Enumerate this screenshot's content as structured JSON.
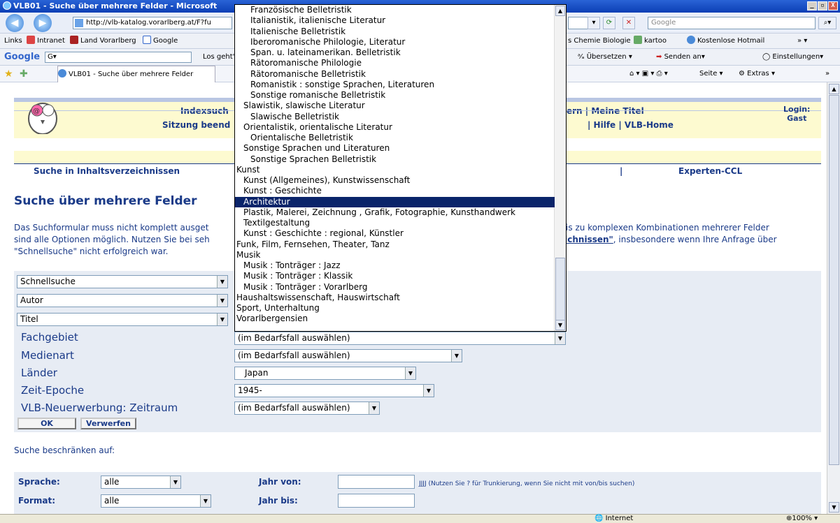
{
  "window": {
    "title": "VLB01 - Suche über mehrere Felder - Microsoft",
    "btns": [
      "_",
      "▫",
      "X"
    ]
  },
  "address": {
    "url": "http://vlb-katalog.vorarlberg.at/F?fu",
    "search_placeholder": "Google"
  },
  "links": {
    "label": "Links",
    "items": [
      "Intranet",
      "Land Vorarlberg",
      "Google"
    ],
    "right_items": [
      "s Chemie Biologie",
      "kartoo",
      "Kostenlose Hotmail"
    ]
  },
  "googlebar": {
    "logo": "Google",
    "field": "G▾",
    "mid": "Los geht's",
    "translate": "Übersetzen",
    "send": "Senden an▾",
    "settings": "Einstellungen▾"
  },
  "tab": {
    "label": "VLB01 - Suche über mehrere Felder",
    "page": "Seite",
    "extras": "Extras"
  },
  "header": {
    "row1a": "Indexsuch",
    "row1b": "ern | Meine Titel",
    "row2a": "Sitzung beend",
    "row2b": "| Hilfe | VLB-Home",
    "login": "Login:",
    "login_user": "Gast"
  },
  "nav": {
    "left": "Suche in Inhaltsverzeichnissen",
    "sep": "|",
    "right": "Experten-CCL"
  },
  "page": {
    "title": "Suche über mehrere Felder",
    "intro_l1a": "Das Suchformular muss nicht komplett ausget",
    "intro_l1b": "d bis zu komplexen Kombinationen mehrerer Felder",
    "intro_l2a": "sind alle Optionen möglich. Nutzen Sie bei seh",
    "intro_l2b": "eichnissen\"",
    "intro_l2c": ", insbesondere wenn Ihre Anfrage über",
    "intro_l3": "\"Schnellsuche\" nicht erfolgreich war."
  },
  "form": {
    "field_selects": [
      "Schnellsuche",
      "Autor",
      "Titel"
    ],
    "labels": [
      "Fachgebiet",
      "Medienart",
      "Länder",
      "Zeit-Epoche",
      "VLB-Neuerwerbung: Zeitraum"
    ],
    "values": [
      "(im Bedarfsfall auswählen)",
      "(im Bedarfsfall auswählen)",
      "Japan",
      "1945-",
      "(im Bedarfsfall auswählen)"
    ],
    "ok": "OK",
    "reset": "Verwerfen"
  },
  "limit": {
    "title": "Suche beschränken auf:",
    "sprache_label": "Sprache:",
    "sprache": "alle",
    "format_label": "Format:",
    "format": "alle",
    "jahr_von": "Jahr von:",
    "jahr_bis": "Jahr bis:",
    "hint": "JJJJ (Nutzen Sie ? für Trunkierung, wenn Sie nicht mit von/bis suchen)"
  },
  "dropdown": {
    "selected_index": 19,
    "items": [
      {
        "t": "Französische Belletristik",
        "i": 2
      },
      {
        "t": "Italianistik, italienische Literatur",
        "i": 2
      },
      {
        "t": "Italienische Belletristik",
        "i": 2
      },
      {
        "t": "Iberoromanische Philologie, Literatur",
        "i": 2
      },
      {
        "t": "Span. u. lateinamerikan. Belletristik",
        "i": 2
      },
      {
        "t": "Rätoromanische Philologie",
        "i": 2
      },
      {
        "t": "Rätoromanische Belletristik",
        "i": 2
      },
      {
        "t": "Romanistik : sonstige Sprachen, Literaturen",
        "i": 2
      },
      {
        "t": "Sonstige romanische Belletristik",
        "i": 2
      },
      {
        "t": "Slawistik, slawische Literatur",
        "i": 1
      },
      {
        "t": "Slawische Belletristik",
        "i": 2
      },
      {
        "t": "Orientalistik, orientalische Literatur",
        "i": 1
      },
      {
        "t": "Orientalische Belletristik",
        "i": 2
      },
      {
        "t": "Sonstige Sprachen und Literaturen",
        "i": 1
      },
      {
        "t": "Sonstige Sprachen Belletristik",
        "i": 2
      },
      {
        "t": "Kunst",
        "i": 0
      },
      {
        "t": "Kunst (Allgemeines), Kunstwissenschaft",
        "i": 1
      },
      {
        "t": "Kunst : Geschichte",
        "i": 1
      },
      {
        "t": "Architektur",
        "i": 1
      },
      {
        "t": "Plastik, Malerei, Zeichnung , Grafik, Fotographie, Kunsthandwerk",
        "i": 1
      },
      {
        "t": "Textilgestaltung",
        "i": 1
      },
      {
        "t": "Kunst : Geschichte : regional, Künstler",
        "i": 1
      },
      {
        "t": "Funk, Film, Fernsehen, Theater, Tanz",
        "i": 0
      },
      {
        "t": "Musik",
        "i": 0
      },
      {
        "t": "Musik : Tonträger : Jazz",
        "i": 1
      },
      {
        "t": "Musik : Tonträger : Klassik",
        "i": 1
      },
      {
        "t": "Musik : Tonträger : Vorarlberg",
        "i": 1
      },
      {
        "t": "Haushaltswissenschaft, Hauswirtschaft",
        "i": 0
      },
      {
        "t": "Sport, Unterhaltung",
        "i": 0
      },
      {
        "t": "Vorarlbergensien",
        "i": 0
      }
    ]
  },
  "status": {
    "zone": "Internet",
    "zoom": "100%"
  }
}
